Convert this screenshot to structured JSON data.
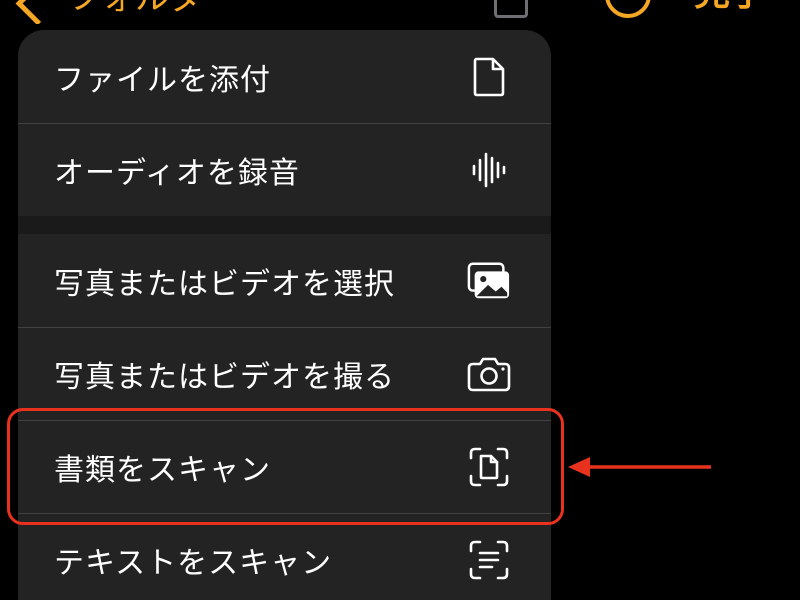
{
  "topbar": {
    "back_label": "フォルダ",
    "done_label": "完了"
  },
  "menu": {
    "items": [
      {
        "label": "ファイルを添付",
        "icon": "document-icon"
      },
      {
        "label": "オーディオを録音",
        "icon": "waveform-icon"
      },
      {
        "label": "写真またはビデオを選択",
        "icon": "photo-library-icon"
      },
      {
        "label": "写真またはビデオを撮る",
        "icon": "camera-icon"
      },
      {
        "label": "書類をスキャン",
        "icon": "doc-scan-icon"
      },
      {
        "label": "テキストをスキャン",
        "icon": "text-scan-icon"
      }
    ]
  },
  "annotation": {
    "highlighted_item": "書類をスキャン",
    "color": "#e8321e"
  },
  "colors": {
    "accent": "#f5a623",
    "menu_background": "#232324",
    "text": "#ffffff"
  }
}
